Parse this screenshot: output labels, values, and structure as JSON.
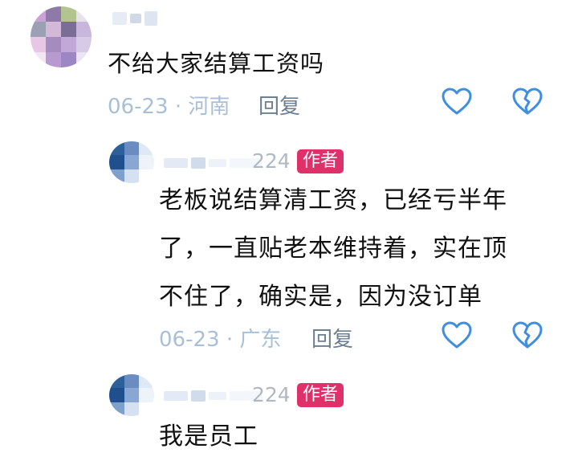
{
  "comments": [
    {
      "text": "不给大家结算工资吗",
      "date": "06-23",
      "location": "河南",
      "separator": "·",
      "reply_label": "回复"
    }
  ],
  "replies": [
    {
      "handle_suffix": "224",
      "badge": "作者",
      "lines": [
        "老板说结算清工资，已经亏半年",
        "了，一直贴老本维持着，实在顶",
        "不住了，确实是，因为没订单"
      ],
      "date": "06-23",
      "location": "广东",
      "separator": "·",
      "reply_label": "回复"
    },
    {
      "handle_suffix": "224",
      "badge": "作者",
      "lines": [
        "我是员工"
      ]
    }
  ],
  "colors": {
    "accent_blue": "#3f8ee0",
    "badge_bg": "#e0306a",
    "meta_gray": "#a9bfd6"
  },
  "icons": [
    "heart-outline-icon",
    "broken-heart-icon"
  ]
}
